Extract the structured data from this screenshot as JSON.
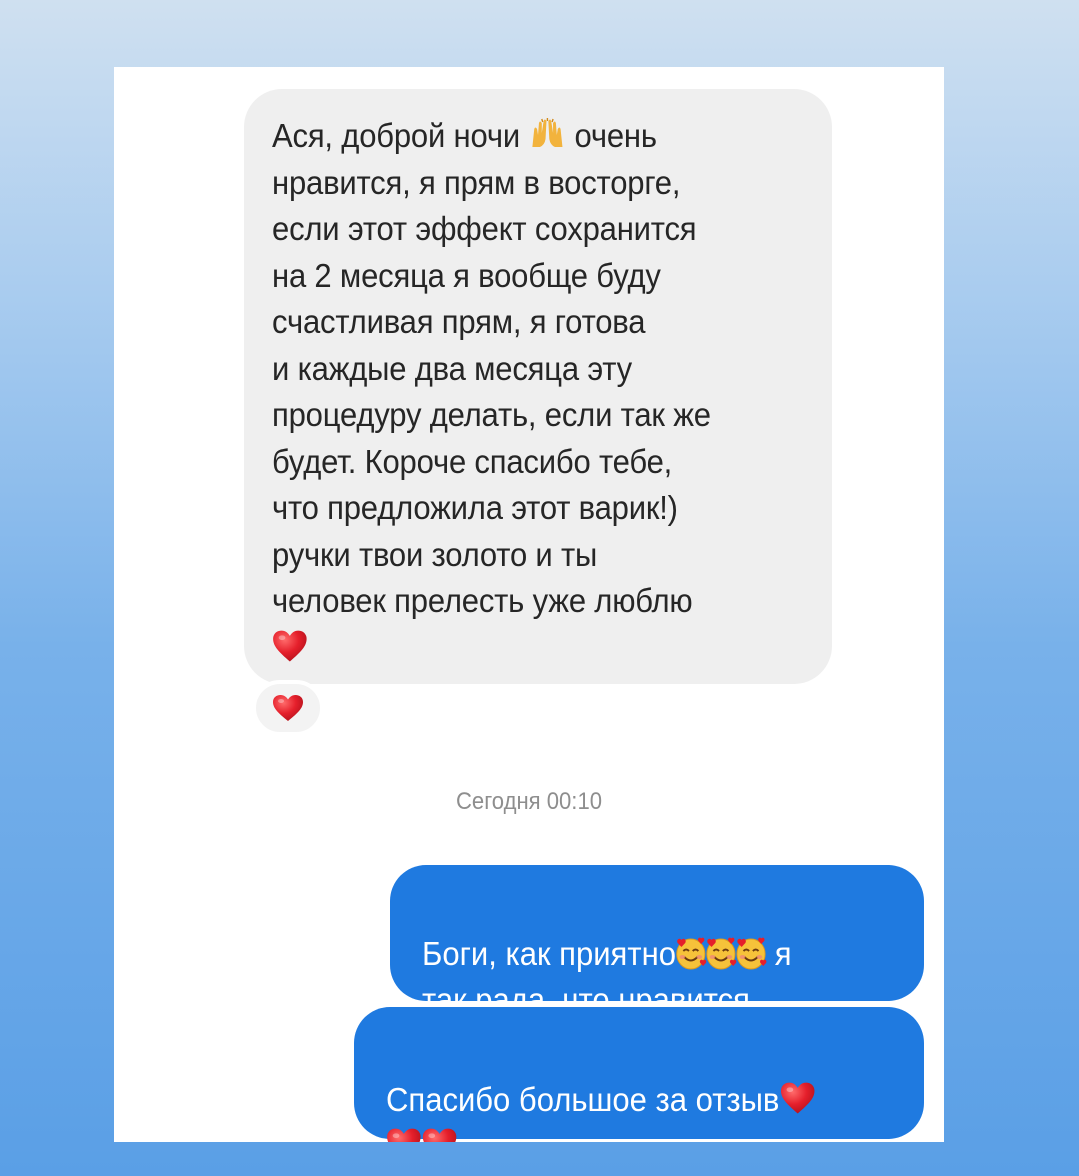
{
  "messages": {
    "incoming": {
      "line1_before_emoji": "Ася, доброй ночи",
      "line1_after_emoji": "очень",
      "body": "нравится, я прям в восторге,\nесли этот эффект сохранится\nна 2 месяца я вообще буду\nсчастливая прям, я готова\nи каждые два месяца эту\nпроцедуру делать, если так же\nбудет. Короче спасибо тебе,\nчто предложила этот варик!)\nручки твои золото и ты\nчеловек прелесть уже люблю",
      "emoji_hands": "raising-hands-icon",
      "emoji_end": "red-heart-icon",
      "reaction": "red-heart-icon"
    },
    "timestamp": "Сегодня 00:10",
    "outgoing": [
      {
        "before_emoji": "Боги, как приятно",
        "after_emoji": " я",
        "line2": "так рада, что нравится...",
        "emoji": "smiling-face-with-hearts-icon"
      },
      {
        "text": "Спасибо большое за отзыв",
        "emoji": "red-heart-icon"
      }
    ]
  },
  "colors": {
    "incoming_bubble": "#efefef",
    "outgoing_bubble": "#1f7ae0",
    "heart": "#e0202e",
    "background_top": "#cfe0f0",
    "background_bottom": "#5a9fe6"
  }
}
